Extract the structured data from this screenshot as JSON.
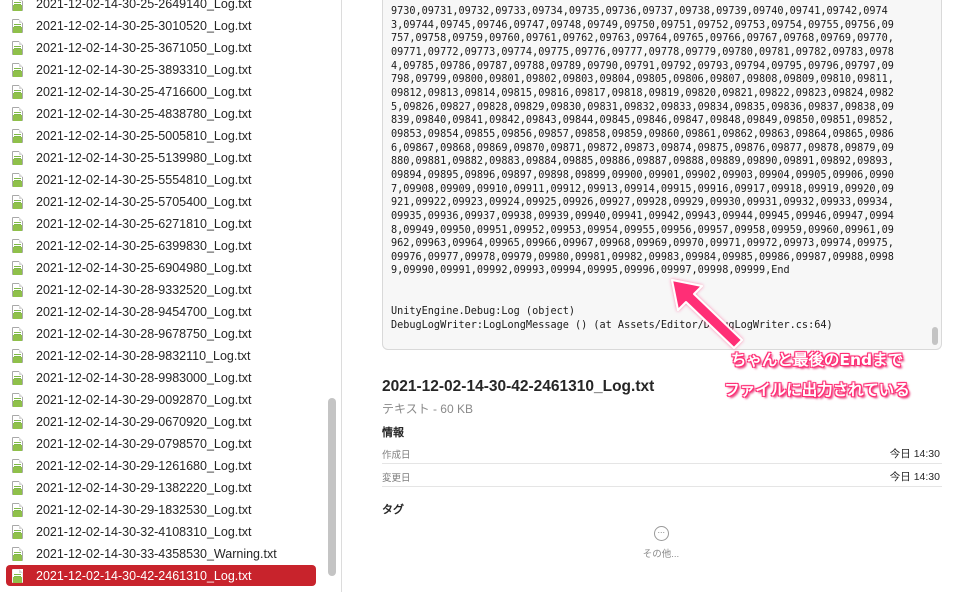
{
  "file_list": {
    "items": [
      {
        "name": "2021-12-02-14-30-25-2649140_Log.txt",
        "selected": false
      },
      {
        "name": "2021-12-02-14-30-25-3010520_Log.txt",
        "selected": false
      },
      {
        "name": "2021-12-02-14-30-25-3671050_Log.txt",
        "selected": false
      },
      {
        "name": "2021-12-02-14-30-25-3893310_Log.txt",
        "selected": false
      },
      {
        "name": "2021-12-02-14-30-25-4716600_Log.txt",
        "selected": false
      },
      {
        "name": "2021-12-02-14-30-25-4838780_Log.txt",
        "selected": false
      },
      {
        "name": "2021-12-02-14-30-25-5005810_Log.txt",
        "selected": false
      },
      {
        "name": "2021-12-02-14-30-25-5139980_Log.txt",
        "selected": false
      },
      {
        "name": "2021-12-02-14-30-25-5554810_Log.txt",
        "selected": false
      },
      {
        "name": "2021-12-02-14-30-25-5705400_Log.txt",
        "selected": false
      },
      {
        "name": "2021-12-02-14-30-25-6271810_Log.txt",
        "selected": false
      },
      {
        "name": "2021-12-02-14-30-25-6399830_Log.txt",
        "selected": false
      },
      {
        "name": "2021-12-02-14-30-25-6904980_Log.txt",
        "selected": false
      },
      {
        "name": "2021-12-02-14-30-28-9332520_Log.txt",
        "selected": false
      },
      {
        "name": "2021-12-02-14-30-28-9454700_Log.txt",
        "selected": false
      },
      {
        "name": "2021-12-02-14-30-28-9678750_Log.txt",
        "selected": false
      },
      {
        "name": "2021-12-02-14-30-28-9832110_Log.txt",
        "selected": false
      },
      {
        "name": "2021-12-02-14-30-28-9983000_Log.txt",
        "selected": false
      },
      {
        "name": "2021-12-02-14-30-29-0092870_Log.txt",
        "selected": false
      },
      {
        "name": "2021-12-02-14-30-29-0670920_Log.txt",
        "selected": false
      },
      {
        "name": "2021-12-02-14-30-29-0798570_Log.txt",
        "selected": false
      },
      {
        "name": "2021-12-02-14-30-29-1261680_Log.txt",
        "selected": false
      },
      {
        "name": "2021-12-02-14-30-29-1382220_Log.txt",
        "selected": false
      },
      {
        "name": "2021-12-02-14-30-29-1832530_Log.txt",
        "selected": false
      },
      {
        "name": "2021-12-02-14-30-32-4108310_Log.txt",
        "selected": false
      },
      {
        "name": "2021-12-02-14-30-33-4358530_Warning.txt",
        "selected": false
      },
      {
        "name": "2021-12-02-14-30-42-2461310_Log.txt",
        "selected": true
      }
    ]
  },
  "preview": {
    "log_text": "9730,09731,09732,09733,09734,09735,09736,09737,09738,09739,09740,09741,09742,09743,09744,09745,09746,09747,09748,09749,09750,09751,09752,09753,09754,09755,09756,09757,09758,09759,09760,09761,09762,09763,09764,09765,09766,09767,09768,09769,09770,09771,09772,09773,09774,09775,09776,09777,09778,09779,09780,09781,09782,09783,09784,09785,09786,09787,09788,09789,09790,09791,09792,09793,09794,09795,09796,09797,09798,09799,09800,09801,09802,09803,09804,09805,09806,09807,09808,09809,09810,09811,09812,09813,09814,09815,09816,09817,09818,09819,09820,09821,09822,09823,09824,09825,09826,09827,09828,09829,09830,09831,09832,09833,09834,09835,09836,09837,09838,09839,09840,09841,09842,09843,09844,09845,09846,09847,09848,09849,09850,09851,09852,09853,09854,09855,09856,09857,09858,09859,09860,09861,09862,09863,09864,09865,09866,09867,09868,09869,09870,09871,09872,09873,09874,09875,09876,09877,09878,09879,09880,09881,09882,09883,09884,09885,09886,09887,09888,09889,09890,09891,09892,09893,09894,09895,09896,09897,09898,09899,09900,09901,09902,09903,09904,09905,09906,09907,09908,09909,09910,09911,09912,09913,09914,09915,09916,09917,09918,09919,09920,09921,09922,09923,09924,09925,09926,09927,09928,09929,09930,09931,09932,09933,09934,09935,09936,09937,09938,09939,09940,09941,09942,09943,09944,09945,09946,09947,09948,09949,09950,09951,09952,09953,09954,09955,09956,09957,09958,09959,09960,09961,09962,09963,09964,09965,09966,09967,09968,09969,09970,09971,09972,09973,09974,09975,09976,09977,09978,09979,09980,09981,09982,09983,09984,09985,09986,09987,09988,09989,09990,09991,09992,09993,09994,09995,09996,09997,09998,09999,End",
    "trace_line_1": "UnityEngine.Debug:Log (object)",
    "trace_line_2": "DebugLogWriter:LogLongMessage () (at Assets/Editor/DebugLogWriter.cs:64)"
  },
  "annotation": {
    "line_1": "ちゃんと最後のEndまで",
    "line_2": "ファイルに出力されている",
    "color": "#ff2f76"
  },
  "info": {
    "file_name": "2021-12-02-14-30-42-2461310_Log.txt",
    "kind_size": "テキスト - 60 KB",
    "section_heading": "情報",
    "created_label": "作成日",
    "created_value": "今日 14:30",
    "modified_label": "変更日",
    "modified_value": "今日 14:30",
    "tags_heading": "タグ",
    "more_label": "その他...",
    "more_icon": "ellipsis-circle-icon"
  },
  "colors": {
    "selection": "#c8232c",
    "file_icon_accent": "#8fc04a"
  }
}
